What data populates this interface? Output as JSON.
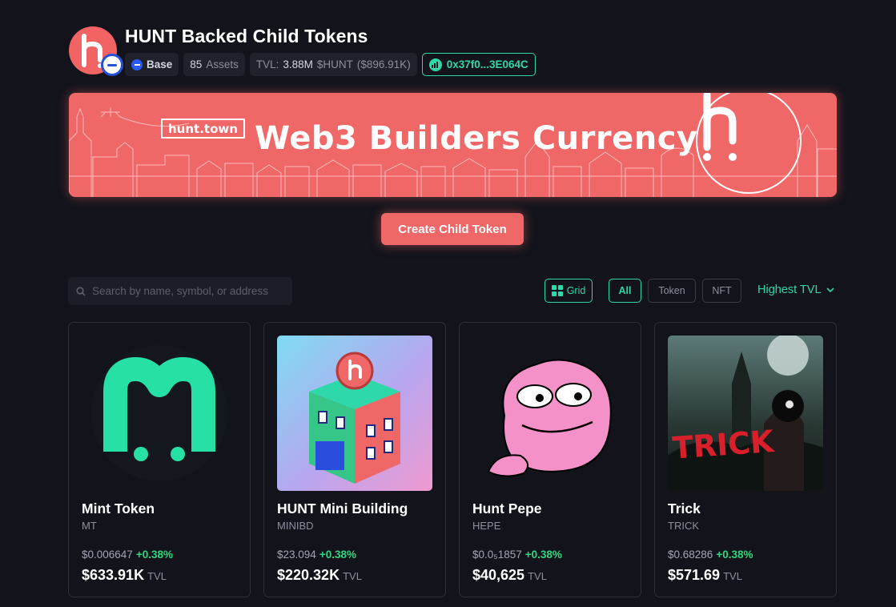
{
  "header": {
    "title": "HUNT Backed Child Tokens",
    "chain": "Base",
    "assets_count": "85",
    "assets_label": "Assets",
    "tvl_label": "TVL:",
    "tvl_value": "3.88M",
    "tvl_unit": "$HUNT",
    "tvl_usd": "($896.91K)",
    "address": "0x37f0...3E064C"
  },
  "banner": {
    "tag": "hunt.town",
    "headline": "Web3 Builders Currency"
  },
  "cta": {
    "label": "Create Child Token"
  },
  "filters": {
    "search_placeholder": "Search by name, symbol, or address",
    "view_label": "Grid",
    "types": [
      "All",
      "Token",
      "NFT"
    ],
    "active_type": "All",
    "sort_label": "Highest TVL"
  },
  "colors": {
    "background": "#12131b",
    "accent": "#2fd8a8",
    "brand": "#f06768",
    "positive": "#2fd880"
  },
  "tokens": [
    {
      "name": "Mint Token",
      "symbol": "MT",
      "price": "$0.006647",
      "change": "+0.38%",
      "tvl": "$633.91K",
      "tvl_unit": "TVL"
    },
    {
      "name": "HUNT Mini Building",
      "symbol": "MINIBD",
      "price": "$23.094",
      "change": "+0.38%",
      "tvl": "$220.32K",
      "tvl_unit": "TVL"
    },
    {
      "name": "Hunt Pepe",
      "symbol": "HEPE",
      "price": "$0.0₅1857",
      "change": "+0.38%",
      "tvl": "$40,625",
      "tvl_unit": "TVL"
    },
    {
      "name": "Trick",
      "symbol": "TRICK",
      "price": "$0.68286",
      "change": "+0.38%",
      "tvl": "$571.69",
      "tvl_unit": "TVL"
    }
  ]
}
